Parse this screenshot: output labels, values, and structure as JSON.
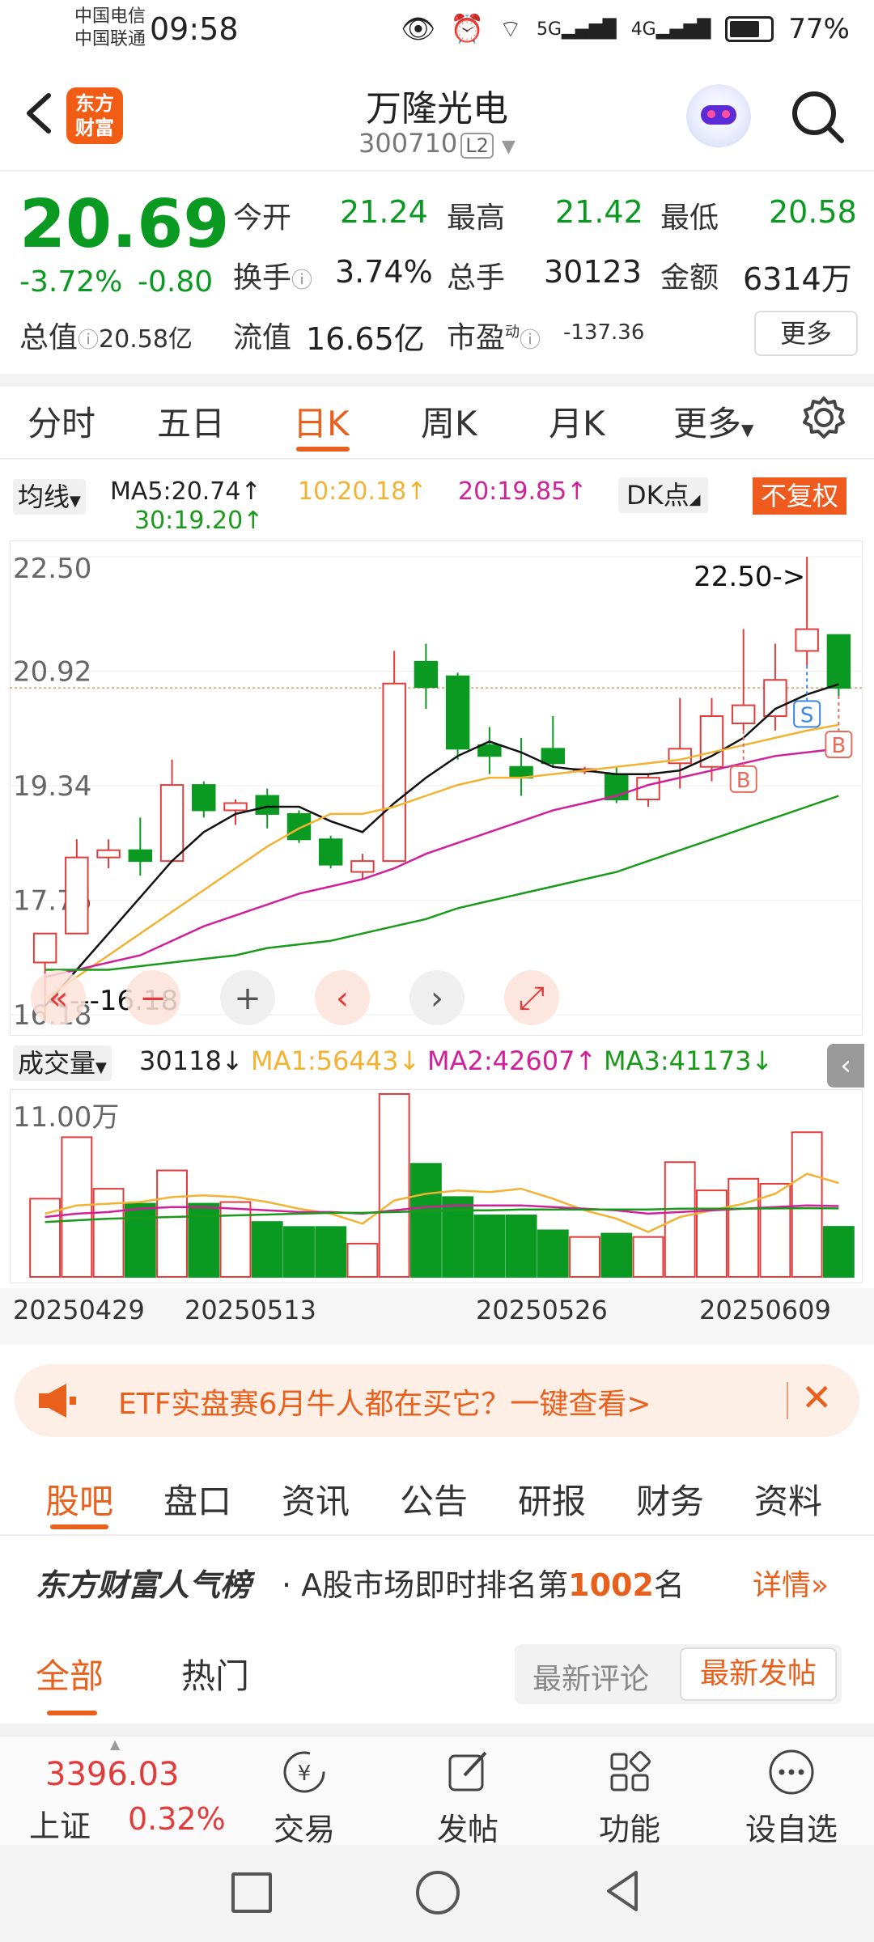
{
  "status_bar": {
    "carrier1": "中国电信",
    "carrier2": "中国联通",
    "time": "09:58",
    "net1": "5G",
    "net2": "4G",
    "battery": "77%"
  },
  "header": {
    "logo_line1": "东方",
    "logo_line2": "财富",
    "stock_name": "万隆光电",
    "stock_code": "300710",
    "level_badge": "L2"
  },
  "quote": {
    "price": "20.69",
    "change_pct": "-3.72%",
    "change": "-0.80",
    "open_label": "今开",
    "open": "21.24",
    "high_label": "最高",
    "high": "21.42",
    "low_label": "最低",
    "low": "20.58",
    "turnover_label": "换手",
    "turnover": "3.74%",
    "volume_label": "总手",
    "volume": "30123",
    "amount_label": "金额",
    "amount": "6314万",
    "mktcap_label": "总值",
    "mktcap": "20.58亿",
    "float_label": "流值",
    "float": "16.65亿",
    "pe_label": "市盈",
    "pe_sup": "动",
    "pe": "-137.36",
    "more": "更多"
  },
  "periods": [
    "分时",
    "五日",
    "日K",
    "周K",
    "月K",
    "更多"
  ],
  "active_period": "日K",
  "chart_info": {
    "ma_type": "均线",
    "ma5": "MA5:20.74↑",
    "ma10": "10:20.18↑",
    "ma20": "20:19.85↑",
    "ma30": "30:19.20↑",
    "dk": "DK点",
    "adjust": "不复权"
  },
  "chart_labels": {
    "high_marker": "22.50->",
    "low_marker": "<---16.18",
    "sell_badge": "S",
    "buy_badge": "B"
  },
  "volume_info": {
    "label": "成交量",
    "vol": "30118↓",
    "ma1": "MA1:56443↓",
    "ma2": "MA2:42607↑",
    "ma3": "MA3:41173↓"
  },
  "chart_data": [
    {
      "type": "candlestick",
      "title": "",
      "y_ticks": [
        "22.50",
        "20.92",
        "19.34",
        "17.76",
        "16.18"
      ],
      "ylim": [
        16.18,
        22.5
      ],
      "x_dates_shown": [
        "20250429",
        "20250513",
        "20250526",
        "20250609"
      ],
      "candles": [
        {
          "o": 16.9,
          "h": 17.3,
          "l": 16.18,
          "c": 17.3
        },
        {
          "o": 17.3,
          "h": 18.6,
          "l": 17.3,
          "c": 18.35
        },
        {
          "o": 18.35,
          "h": 18.6,
          "l": 18.2,
          "c": 18.45
        },
        {
          "o": 18.45,
          "h": 18.9,
          "l": 18.1,
          "c": 18.3
        },
        {
          "o": 18.3,
          "h": 19.7,
          "l": 18.3,
          "c": 19.35
        },
        {
          "o": 19.35,
          "h": 19.4,
          "l": 18.9,
          "c": 19.0
        },
        {
          "o": 19.0,
          "h": 19.15,
          "l": 18.8,
          "c": 19.1
        },
        {
          "o": 19.2,
          "h": 19.3,
          "l": 18.75,
          "c": 18.95
        },
        {
          "o": 18.95,
          "h": 19.0,
          "l": 18.55,
          "c": 18.6
        },
        {
          "o": 18.6,
          "h": 18.65,
          "l": 18.2,
          "c": 18.25
        },
        {
          "o": 18.15,
          "h": 18.4,
          "l": 18.05,
          "c": 18.3
        },
        {
          "o": 18.3,
          "h": 21.2,
          "l": 18.3,
          "c": 20.75
        },
        {
          "o": 21.05,
          "h": 21.3,
          "l": 20.4,
          "c": 20.7
        },
        {
          "o": 20.85,
          "h": 20.9,
          "l": 19.7,
          "c": 19.85
        },
        {
          "o": 19.9,
          "h": 20.15,
          "l": 19.5,
          "c": 19.75
        },
        {
          "o": 19.6,
          "h": 20.0,
          "l": 19.2,
          "c": 19.45
        },
        {
          "o": 19.85,
          "h": 20.3,
          "l": 19.6,
          "c": 19.65
        },
        {
          "o": 19.55,
          "h": 19.6,
          "l": 19.5,
          "c": 19.57
        },
        {
          "o": 19.5,
          "h": 19.6,
          "l": 19.1,
          "c": 19.15
        },
        {
          "o": 19.15,
          "h": 19.5,
          "l": 19.05,
          "c": 19.45
        },
        {
          "o": 19.65,
          "h": 20.55,
          "l": 19.3,
          "c": 19.85
        },
        {
          "o": 19.6,
          "h": 20.55,
          "l": 19.4,
          "c": 20.3
        },
        {
          "o": 20.2,
          "h": 21.5,
          "l": 20.1,
          "c": 20.45
        },
        {
          "o": 20.3,
          "h": 21.3,
          "l": 20.1,
          "c": 20.8
        },
        {
          "o": 21.2,
          "h": 22.5,
          "l": 21.0,
          "c": 21.5
        },
        {
          "o": 21.42,
          "h": 21.42,
          "l": 20.58,
          "c": 20.69
        }
      ],
      "ma5": [
        16.3,
        16.8,
        17.3,
        17.8,
        18.3,
        18.7,
        18.95,
        19.05,
        19.05,
        18.85,
        18.7,
        19.1,
        19.45,
        19.75,
        19.95,
        19.8,
        19.6,
        19.55,
        19.5,
        19.5,
        19.55,
        19.75,
        20.0,
        20.4,
        20.6,
        20.74
      ],
      "ma10": [
        16.4,
        16.7,
        17.0,
        17.3,
        17.6,
        17.9,
        18.2,
        18.5,
        18.75,
        18.95,
        18.95,
        19.05,
        19.2,
        19.35,
        19.45,
        19.45,
        19.5,
        19.55,
        19.6,
        19.65,
        19.7,
        19.8,
        19.9,
        20.0,
        20.1,
        20.18
      ],
      "ma20": [
        16.7,
        16.8,
        16.9,
        17.0,
        17.2,
        17.4,
        17.55,
        17.7,
        17.85,
        17.95,
        18.05,
        18.2,
        18.4,
        18.55,
        18.7,
        18.85,
        19.0,
        19.1,
        19.2,
        19.35,
        19.45,
        19.55,
        19.65,
        19.75,
        19.8,
        19.85
      ],
      "ma30": [
        16.8,
        16.8,
        16.8,
        16.85,
        16.9,
        16.95,
        17.0,
        17.1,
        17.15,
        17.2,
        17.3,
        17.4,
        17.5,
        17.65,
        17.75,
        17.85,
        17.95,
        18.05,
        18.15,
        18.3,
        18.45,
        18.6,
        18.75,
        18.9,
        19.05,
        19.2
      ]
    },
    {
      "type": "bar",
      "title": "",
      "y_max_label": "11.00万",
      "ylim": [
        0,
        110000
      ],
      "values": [
        47000,
        84000,
        53000,
        44000,
        64000,
        44000,
        45000,
        33000,
        30000,
        30000,
        20000,
        110000,
        68000,
        48000,
        37000,
        37000,
        28000,
        24000,
        26000,
        24000,
        69000,
        52000,
        59000,
        56000,
        87000,
        30118
      ],
      "ma1": [
        38000,
        43000,
        44000,
        45000,
        48000,
        49000,
        48000,
        45000,
        41000,
        38000,
        32000,
        46000,
        50000,
        52000,
        51000,
        53000,
        47000,
        40000,
        35000,
        27000,
        36000,
        40000,
        44000,
        50000,
        62000,
        56443
      ],
      "ma2": [
        36000,
        38000,
        39000,
        41000,
        42000,
        42000,
        41000,
        40000,
        39000,
        39000,
        38000,
        40000,
        42000,
        43000,
        43000,
        43000,
        42000,
        41000,
        40000,
        38000,
        39000,
        40000,
        41000,
        42000,
        43000,
        42607
      ],
      "ma3": [
        33000,
        34000,
        35000,
        35500,
        36000,
        36500,
        37000,
        37500,
        38000,
        38500,
        38500,
        39000,
        39500,
        40000,
        40000,
        40500,
        40500,
        40500,
        40500,
        40500,
        41000,
        41000,
        41000,
        41200,
        41300,
        41173
      ]
    }
  ],
  "banner": {
    "text": "ETF实盘赛6月牛人都在买它？一键查看>"
  },
  "subtabs": [
    "股吧",
    "盘口",
    "资讯",
    "公告",
    "研报",
    "财务",
    "资料"
  ],
  "active_subtab": "股吧",
  "rank": {
    "brand": "东方财富人气榜",
    "prefix": "· A股市场即时排名第",
    "number": "1002",
    "suffix": "名",
    "detail": "详情"
  },
  "filters": {
    "all": "全部",
    "hot": "热门",
    "latest_comment": "最新评论",
    "latest_post": "最新发帖"
  },
  "bottom_nav": {
    "index_value": "3396.03",
    "index_name": "上证",
    "index_change": "0.32%",
    "items": [
      "交易",
      "发帖",
      "功能",
      "设自选"
    ]
  },
  "colors": {
    "up": "#e23b3b",
    "down": "#0a9a22",
    "accent": "#e8601c",
    "ma5": "#111111",
    "ma10": "#f2b232",
    "ma20": "#d0209a",
    "ma30": "#1a9a1a"
  }
}
